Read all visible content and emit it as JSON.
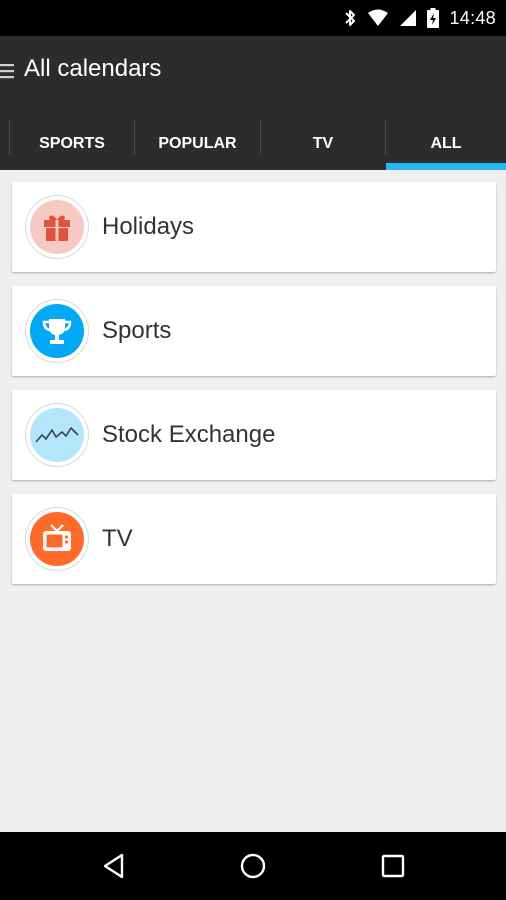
{
  "status_bar": {
    "time": "14:48",
    "icons": [
      "bluetooth-icon",
      "wifi-icon",
      "cell-signal-icon",
      "battery-charging-icon"
    ]
  },
  "app_bar": {
    "title": "All calendars",
    "menu_icon": "menu-icon"
  },
  "tabs": [
    {
      "label": "SPORTS",
      "selected": false
    },
    {
      "label": "POPULAR",
      "selected": false
    },
    {
      "label": "TV",
      "selected": false
    },
    {
      "label": "ALL",
      "selected": true
    }
  ],
  "colors": {
    "accent": "#29b6f6",
    "app_bar": "#2c2c2c",
    "background": "#efefef"
  },
  "calendars": [
    {
      "label": "Holidays",
      "icon": "gift-icon",
      "icon_bg": "#f7c9c4",
      "icon_fg": "#e0533c"
    },
    {
      "label": "Sports",
      "icon": "trophy-icon",
      "icon_bg": "#03a9f4",
      "icon_fg": "#ffffff"
    },
    {
      "label": "Stock Exchange",
      "icon": "stock-chart-icon",
      "icon_bg": "#b3e5fc",
      "icon_fg": "#37474f"
    },
    {
      "label": "TV",
      "icon": "tv-icon",
      "icon_bg": "#ff6a2b",
      "icon_fg": "#ffffff"
    }
  ],
  "nav_bar": {
    "buttons": [
      "back-icon",
      "home-icon",
      "recents-icon"
    ]
  }
}
